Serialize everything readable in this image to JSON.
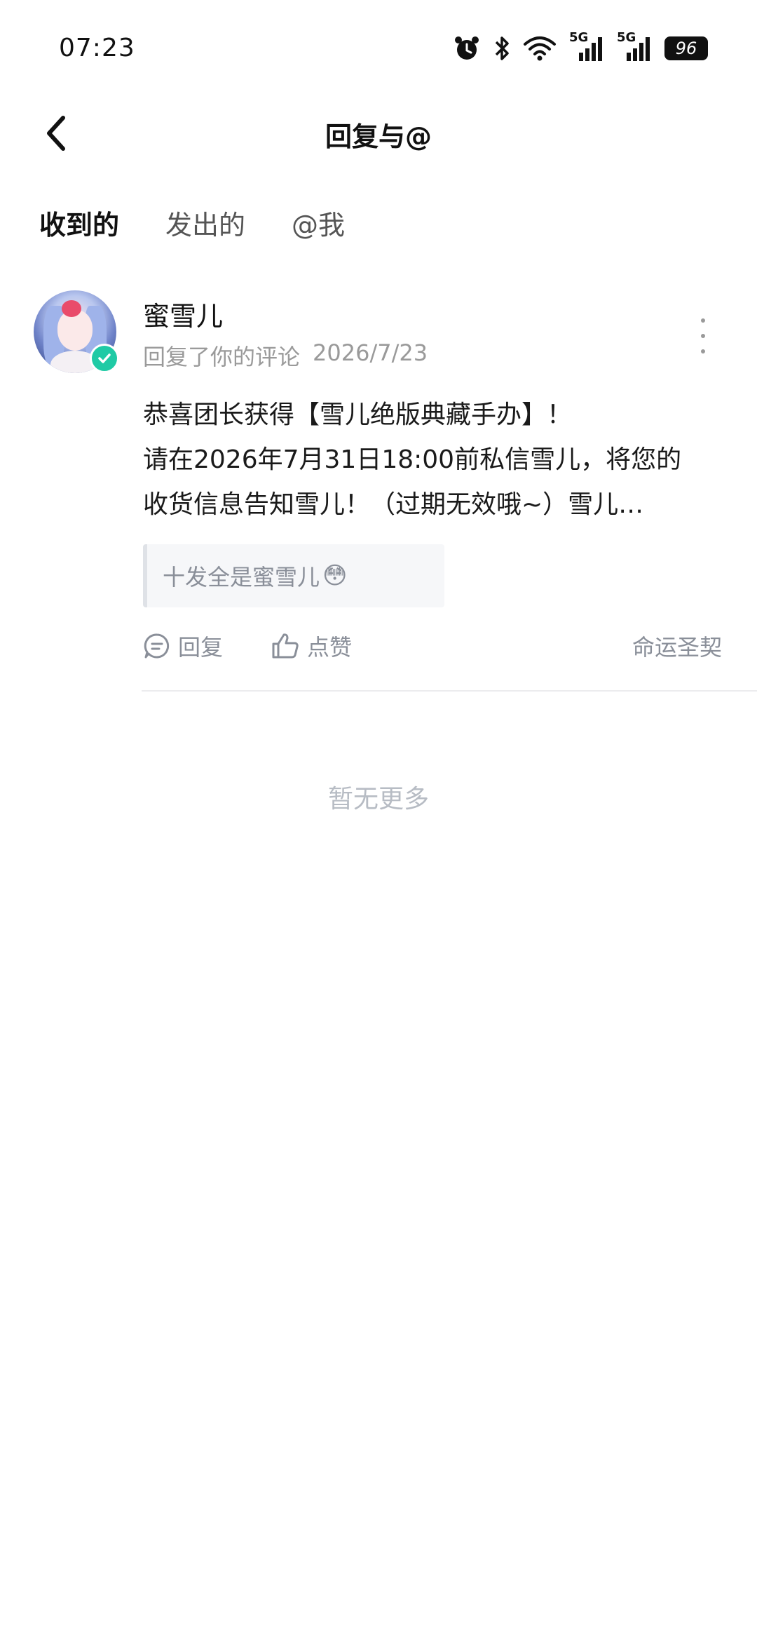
{
  "status_bar": {
    "time": "07:23",
    "battery": "96",
    "network_1": "5G",
    "network_2": "5G",
    "icons": [
      "alarm-icon",
      "bluetooth-icon",
      "wifi-icon",
      "signal-icon",
      "signal-icon",
      "battery-icon"
    ]
  },
  "header": {
    "title": "回复与@"
  },
  "tabs": [
    {
      "label": "收到的",
      "active": true
    },
    {
      "label": "发出的",
      "active": false
    },
    {
      "label": "@我",
      "active": false
    }
  ],
  "notification": {
    "username": "蜜雪儿",
    "action_text": "回复了你的评论",
    "date": "2026/7/23",
    "content_lines": [
      "恭喜团长获得【雪儿绝版典藏手办】！",
      "请在2026年7月31日18:00前私信雪儿，将您的",
      "收货信息告知雪儿！（过期无效哦~）雪儿…"
    ],
    "quoted_comment": "十发全是蜜雪儿",
    "quoted_emoji": "😳",
    "reply_label": "回复",
    "like_label": "点赞",
    "source_label": "命运圣契"
  },
  "footer": {
    "no_more_text": "暂无更多"
  },
  "colors": {
    "accent": "#19d0b4",
    "verified": "#1fcaa5",
    "muted_text": "#8a8f99"
  }
}
